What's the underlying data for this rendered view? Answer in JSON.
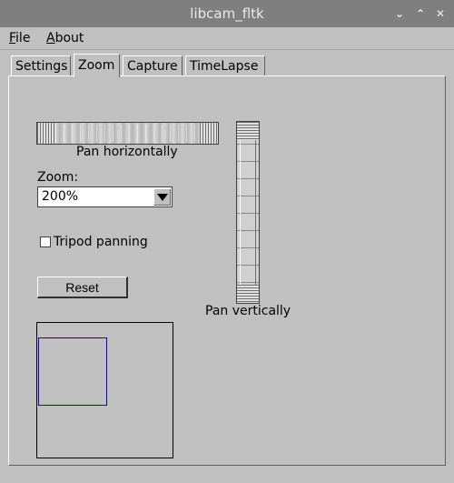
{
  "window": {
    "title": "libcam_fltk",
    "controls": [
      "chevron-down-icon",
      "chevron-up-icon",
      "close-icon"
    ]
  },
  "menu": {
    "items": [
      {
        "label": "File",
        "mnemonic": "F",
        "rest": "ile"
      },
      {
        "label": "About",
        "mnemonic": "A",
        "rest": "bout"
      }
    ]
  },
  "tabs": [
    {
      "label": "Settings",
      "active": false
    },
    {
      "label": "Zoom",
      "active": true
    },
    {
      "label": "Capture",
      "active": false
    },
    {
      "label": "TimeLapse",
      "active": false
    }
  ],
  "zoom_tab": {
    "pan_horizontal_label": "Pan horizontally",
    "pan_vertical_label": "Pan vertically",
    "zoom_label": "Zoom:",
    "zoom_value": "200%",
    "tripod_label": "Tripod panning",
    "tripod_checked": false,
    "reset_label": "Reset",
    "viewport_color": "#0000d0"
  }
}
